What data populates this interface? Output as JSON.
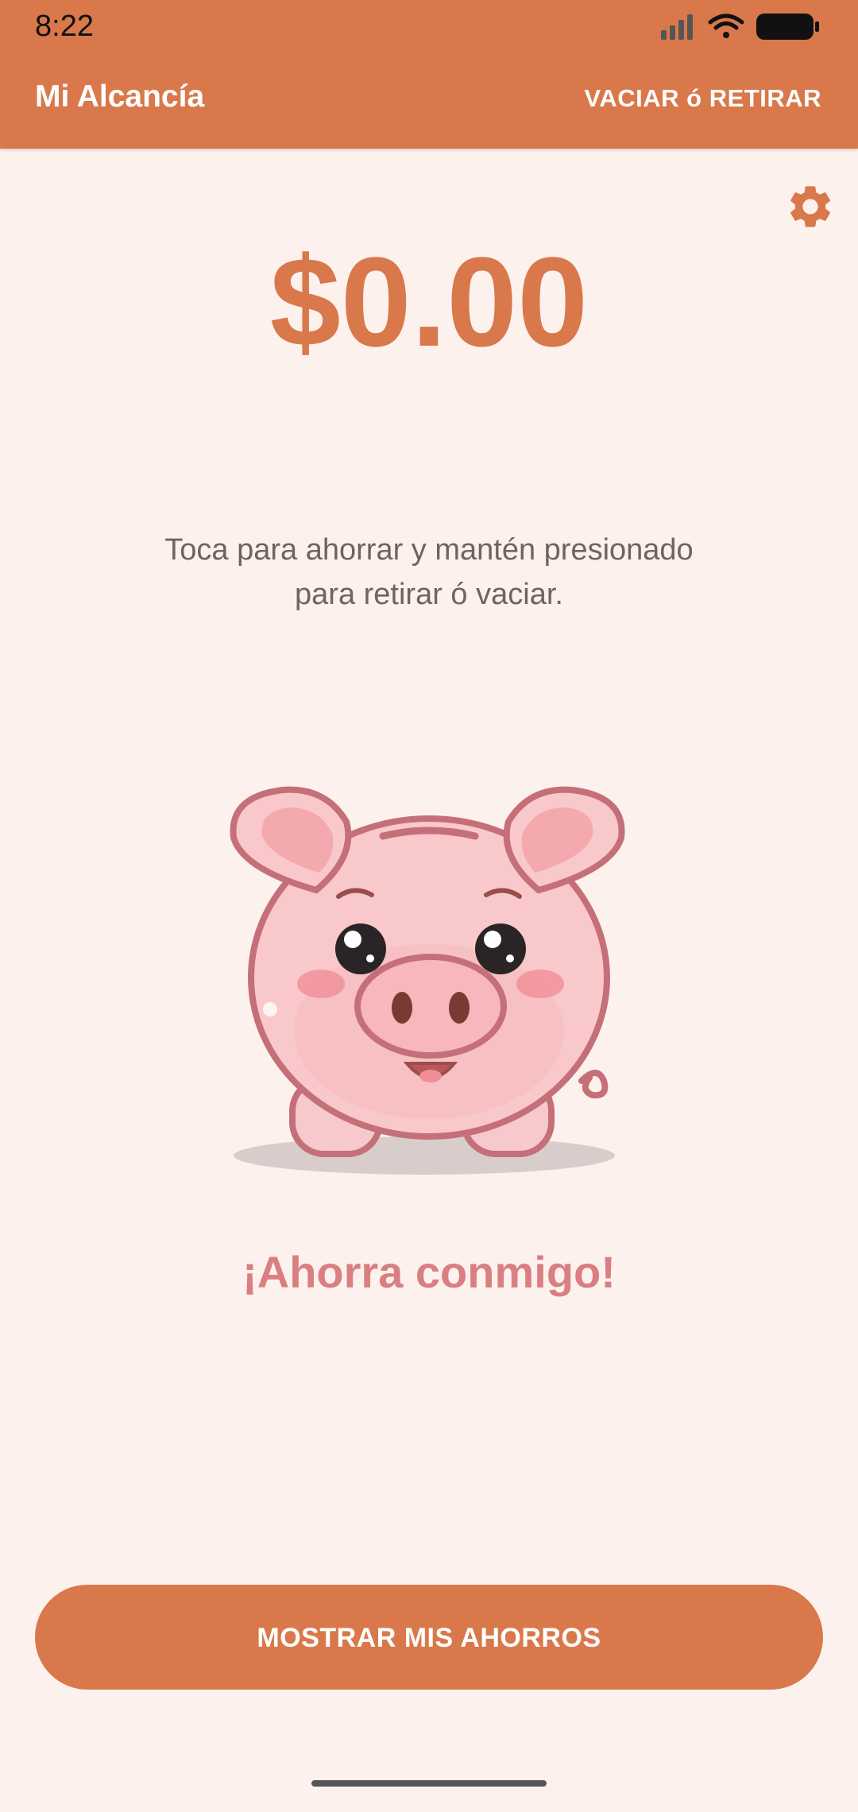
{
  "status_bar": {
    "time": "8:22",
    "icons": [
      "signal-icon",
      "wifi-icon",
      "battery-icon"
    ]
  },
  "app_bar": {
    "title": "Mi Alcancía",
    "action_label": "VACIAR ó RETIRAR"
  },
  "settings": {
    "icon": "gear-icon"
  },
  "savings": {
    "balance": "$0.00"
  },
  "instructions": {
    "line1": "Toca para ahorrar y mantén presionado",
    "line2": "para retirar ó vaciar."
  },
  "illustration": {
    "icon": "piggy-bank-icon"
  },
  "slogan": "¡Ahorra conmigo!",
  "primary_action": {
    "label": "MOSTRAR MIS AHORROS"
  },
  "colors": {
    "accent": "#D9784A",
    "background": "#FDF1EE",
    "slogan": "#D97F82",
    "text_muted": "#6E6462"
  }
}
